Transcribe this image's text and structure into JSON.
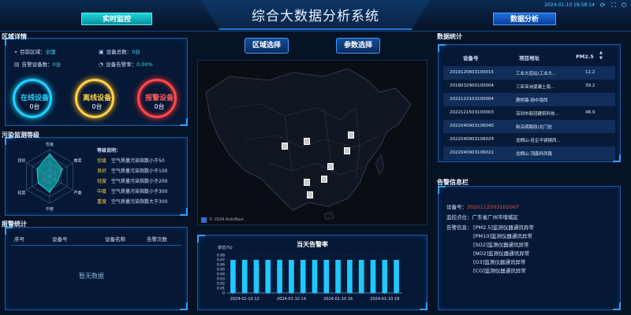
{
  "header": {
    "title": "综合大数据分析系统",
    "left_tab": "实时监控",
    "right_tab": "数据分析",
    "datetime": "2024-01-10 18:58:14"
  },
  "colors": {
    "online": "#1fd3ff",
    "offline": "#ffd24a",
    "alarm": "#ff4a4a",
    "accent": "#2fa0ff",
    "bar": "#1fc8ff"
  },
  "region": {
    "title": "区域详情",
    "current_region_label": "目前区域：",
    "current_region_value": "全国",
    "device_total_label": "设备总数：",
    "device_total_value": "0台",
    "alarm_devices_label": "告警设备数：",
    "alarm_devices_value": "0台",
    "alarm_rate_label": "设备告警率：",
    "alarm_rate_value": "0.00%",
    "online": {
      "label": "在线设备",
      "count": "0台"
    },
    "offline": {
      "label": "离线设备",
      "count": "0台"
    },
    "alarm": {
      "label": "报警设备",
      "count": "0台"
    }
  },
  "pollution": {
    "title": "污染监测等级",
    "radar_axes": [
      "优级",
      "重度",
      "严重",
      "中度",
      "轻度",
      "良好"
    ],
    "radar_values": [
      0.85,
      0.55,
      0.35,
      0.6,
      0.5,
      0.55
    ],
    "legend_title": "等级说明：",
    "levels": [
      {
        "level": "优级",
        "desc": "空气质量污染指数小于50",
        "color": "#ffd24a"
      },
      {
        "level": "良好",
        "desc": "空气质量污染指数小于100",
        "color": "#ffd24a"
      },
      {
        "level": "轻度",
        "desc": "空气质量污染指数小于200",
        "color": "#ffd24a"
      },
      {
        "level": "中度",
        "desc": "空气质量污染指数小于300",
        "color": "#ffd24a"
      },
      {
        "level": "重度",
        "desc": "空气质量污染指数大于300",
        "color": "#ffd24a"
      }
    ]
  },
  "alarm_stats": {
    "title": "报警统计",
    "columns": [
      "序号",
      "设备号",
      "设备名称",
      "告警次数"
    ],
    "empty": "暂无数据"
  },
  "center": {
    "region_select": "区域选择",
    "param_select": "参数选择",
    "map_copyright": "© 2024 AutoNavi"
  },
  "data_stats": {
    "title": "数据统计",
    "columns": [
      "设备号",
      "项目地址",
      "PM2.5"
    ],
    "rows": [
      {
        "id": "2019120603100015",
        "addr": "工业大道站(工业大...",
        "pm": "12.2"
      },
      {
        "id": "2018032900100004",
        "addr": "三亚亚洲混凝土南...",
        "pm": "39.2"
      },
      {
        "id": "2022122103100004",
        "addr": "鹿桥路-扬中南西",
        "pm": ""
      },
      {
        "id": "2022121503100003",
        "addr": "深圳市翡冠建筑科技...",
        "pm": "48.9"
      },
      {
        "id": "2022040903106040",
        "addr": "新沿绸路段(北门处",
        "pm": ""
      },
      {
        "id": "2022040903106024",
        "addr": "龙栖山-佳企不锈钢西...",
        "pm": ""
      },
      {
        "id": "2022040903106022",
        "addr": "龙栖山-顶鑫科西路",
        "pm": ""
      }
    ]
  },
  "alarm_info": {
    "title": "告警信息栏",
    "device_label": "设备号：",
    "device_value": "2020112503102007",
    "location_label": "监控点位：",
    "location_value": "广东省广州市增城区",
    "info_label": "告警信息：",
    "messages": [
      "[PM2.5]监测仪器通讯异常",
      "[PM10]监测仪器通讯异常",
      "[SO2]监测仪器通讯异常",
      "[NO2]监测仪器通讯异常",
      "[O3]监测仪器通讯异常",
      "[CO]监测仪器通讯异常"
    ]
  },
  "chart_data": {
    "type": "bar",
    "title": "当天告警率",
    "ylabel": "单位(%)",
    "ylim": [
      0,
      0.08
    ],
    "yticks": [
      "0",
      "0.01",
      "0.02",
      "0.03",
      "0.04",
      "0.05",
      "0.06",
      "0.07",
      "0.08"
    ],
    "xticks": [
      "2024-01-10 12",
      "2024-01-10 14",
      "2024-01-10 16",
      "2024-01-10 18"
    ],
    "values": [
      0.07,
      0.07,
      0.07,
      0.07,
      0.07,
      0.07,
      0.07,
      0.07,
      0.07,
      0.07,
      0.07,
      0.07,
      0.07,
      0.07,
      0.07
    ]
  }
}
